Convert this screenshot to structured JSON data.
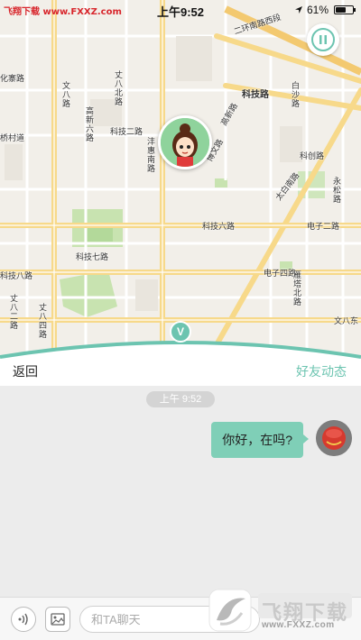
{
  "status_bar": {
    "left_brand": "飞翔下载 www.FXXZ.com",
    "time": "上午9:52",
    "battery_text": "61%",
    "battery_level": 0.61
  },
  "map": {
    "labels": {
      "erhuan": "二环南路西段",
      "kejilu": "科技路",
      "kejierlu": "科技二路",
      "keji_liulu": "科技六路",
      "keji_qilu": "科技七路",
      "keji_balu": "科技八路",
      "kechuanglu": "科创路",
      "dianzi_erlu": "电子二路",
      "dianzi_silu": "电子四路",
      "wenba_dong": "文八东",
      "yanta": "雁塔",
      "taibai_nanlu": "太白南路",
      "zhangba_erlu": "丈八二路",
      "zhangba_silu": "丈八四路",
      "zhangba_beilu": "丈八北路",
      "wenba_road": "文八路",
      "gaoxin_liulu": "高新六路",
      "gaoxin_lu": "高新路",
      "baiziting": "白沙路",
      "yongsong": "永松路",
      "fengshang_nanlu": "沣惠南路",
      "bowenlu": "博文路",
      "keji_road": "科技路",
      "huayuan": "化寨路",
      "qiaocun": "桥村道",
      "yanta_nan": "雁塔北路"
    }
  },
  "panel": {
    "back_label": "返回",
    "feed_label": "好友动态"
  },
  "marker": {
    "v_label": "V"
  },
  "chat": {
    "timestamp": "上午 9:52",
    "messages": [
      {
        "text": "你好，在吗?",
        "from": "me"
      }
    ]
  },
  "input_bar": {
    "placeholder": "和TA聊天"
  },
  "watermark": {
    "brand": "飞翔下载",
    "url": "www.FXXZ.com"
  },
  "colors": {
    "accent": "#6cc4b0",
    "bubble": "#7fcfb7",
    "brand_red": "#d8262c"
  }
}
